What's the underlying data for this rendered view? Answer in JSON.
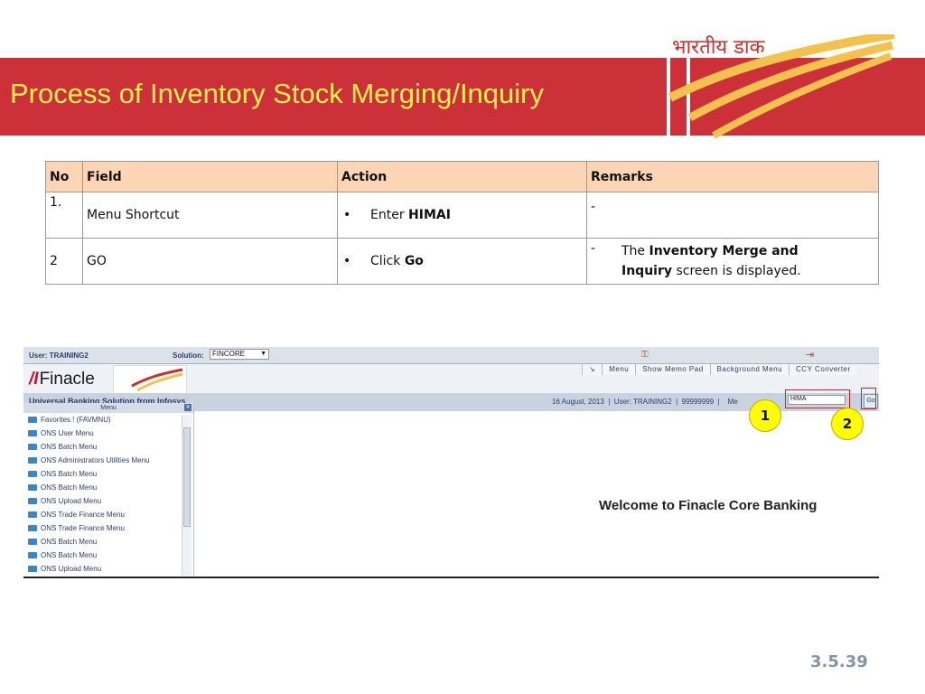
{
  "slide": {
    "title": "Process of Inventory Stock Merging/Inquiry",
    "logo_text": "भारतीय डाक",
    "page_number": "3.5.39",
    "colors": {
      "title_band": "#cc3038",
      "title_text": "#fbf24e",
      "header_fill": "#fcd5b5",
      "badge": "#ffff00"
    }
  },
  "steps_table": {
    "headers": [
      "No",
      "Field",
      "Action",
      "Remarks"
    ],
    "rows": [
      {
        "no": "1.",
        "field": "Menu Shortcut",
        "action_prefix": "Enter ",
        "action_bold": "HIMAI",
        "remark_dash": "-",
        "remark_prefix": "",
        "remark_bold": "",
        "remark_suffix": ""
      },
      {
        "no": "2",
        "field": "GO",
        "action_prefix": "Click ",
        "action_bold": "Go",
        "remark_dash": "-",
        "remark_prefix": "The ",
        "remark_bold": "Inventory Merge and Inquiry",
        "remark_suffix": " screen is displayed."
      }
    ]
  },
  "screenshot": {
    "user": "User: TRAINING2",
    "solution_label": "Solution:",
    "solution_value": "FINCORE",
    "brand": "Finacle",
    "brand_mark_icon": "finacle-logo-icon",
    "toolbar": [
      "Menu",
      "Show Memo Pad",
      "Background Menu",
      "CCY Converter"
    ],
    "band_title": "Universal Banking Solution from Infosys",
    "info": "16 August, 2013  |  User: TRAINING2  |  99999999  |    Me",
    "menu_shortcut_value": "HIMA",
    "go_label": "Go",
    "menu_title": "Menu",
    "menu_items": [
      "Favorites ! (FAVMNU)",
      "ONS User Menu",
      "ONS Batch Menu",
      "ONS Administrators Utilities Menu",
      "ONS Batch Menu",
      "ONS Batch Menu",
      "ONS Upload Menu",
      "ONS Trade Finance Menu",
      "ONS Trade Finance Menu",
      "ONS Batch Menu",
      "ONS Batch Menu",
      "ONS Upload Menu"
    ],
    "welcome": "Welcome to Finacle Core Banking"
  },
  "callouts": [
    "1",
    "2"
  ]
}
